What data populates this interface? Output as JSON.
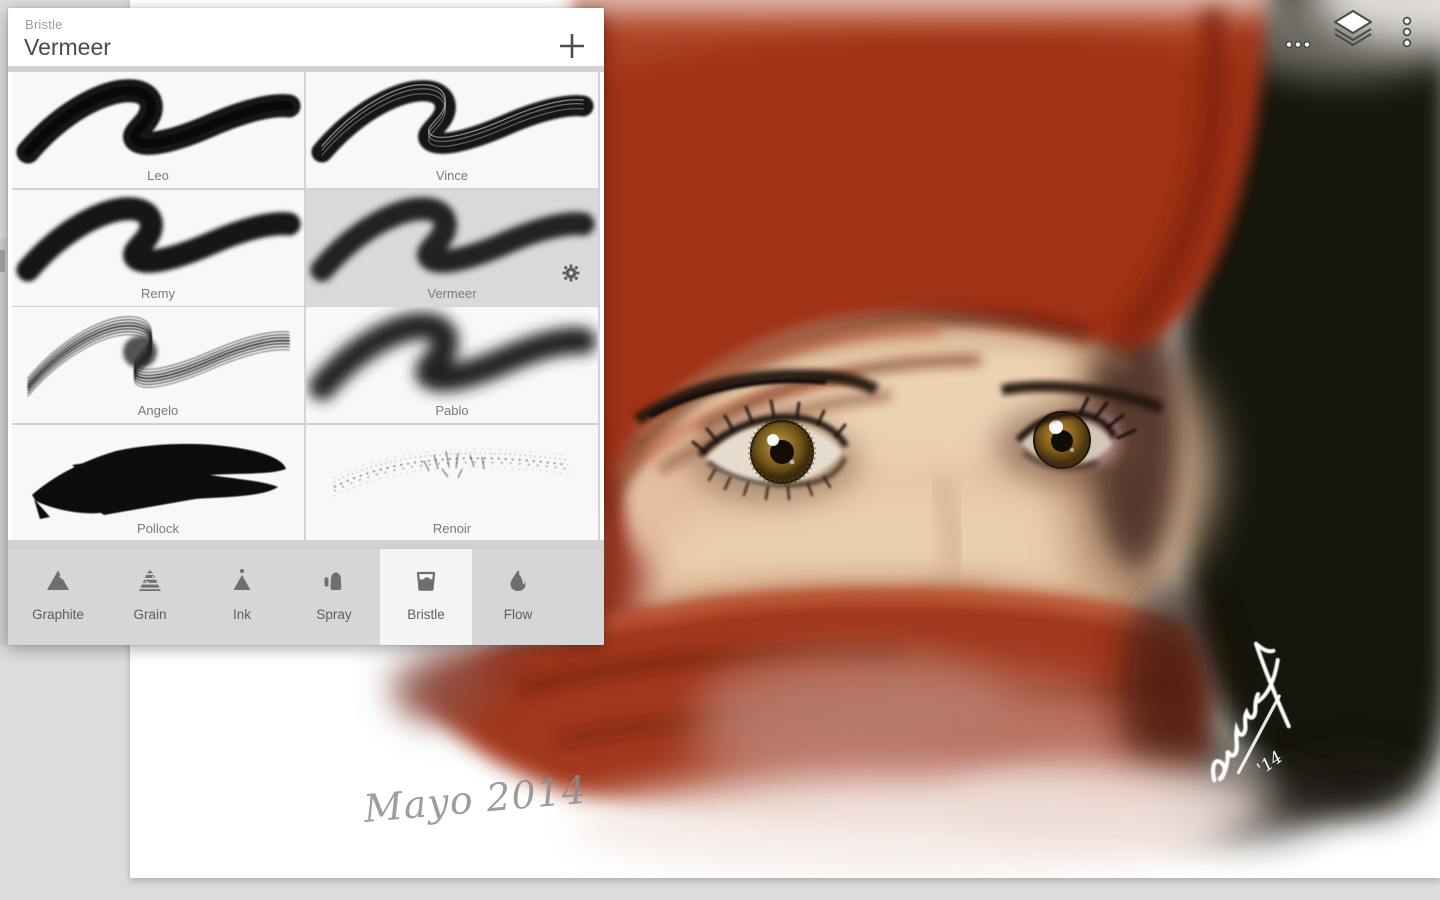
{
  "panel": {
    "category": "Bristle",
    "title": "Vermeer",
    "add_button_icon": "plus-icon",
    "brushes": [
      {
        "name": "Leo",
        "selected": false,
        "style": "solid-swoosh"
      },
      {
        "name": "Vince",
        "selected": false,
        "style": "streaky-swoosh"
      },
      {
        "name": "Remy",
        "selected": false,
        "style": "smooth-swoosh"
      },
      {
        "name": "Vermeer",
        "selected": true,
        "style": "soft-blur-swoosh"
      },
      {
        "name": "Angelo",
        "selected": false,
        "style": "wispy-lines"
      },
      {
        "name": "Pablo",
        "selected": false,
        "style": "very-soft-blur"
      },
      {
        "name": "Pollock",
        "selected": false,
        "style": "heavy-ink-blob"
      },
      {
        "name": "Renoir",
        "selected": false,
        "style": "speckled-scatter"
      }
    ],
    "selected_brush_has": "gear-icon",
    "tabs": [
      {
        "label": "Graphite",
        "icon": "graphite-mountain-icon",
        "selected": false
      },
      {
        "label": "Grain",
        "icon": "grain-striped-triangle-icon",
        "selected": false
      },
      {
        "label": "Ink",
        "icon": "ink-cone-dot-icon",
        "selected": false
      },
      {
        "label": "Spray",
        "icon": "spray-airbrush-icon",
        "selected": false
      },
      {
        "label": "Bristle",
        "icon": "bristle-cup-icon",
        "selected": true
      },
      {
        "label": "Flow",
        "icon": "flow-droplet-icon",
        "selected": false
      }
    ]
  },
  "topbar": {
    "icons": [
      "more-horizontal-dots",
      "layers-stack",
      "more-vertical-dots"
    ]
  },
  "canvas": {
    "inscription": "Mayo 2014",
    "signature_year": "'14"
  },
  "colors": {
    "desktop_bg": "#dcdcdc",
    "panel_bg": "#ffffff",
    "tabbar_bg": "#d6d6d6",
    "selected_cell": "#d9d9d9",
    "scarf_red": "#a2391e",
    "shadow_black": "#191310",
    "skin": "#e3bf9f",
    "iris_hazel": "#8f6f28"
  }
}
